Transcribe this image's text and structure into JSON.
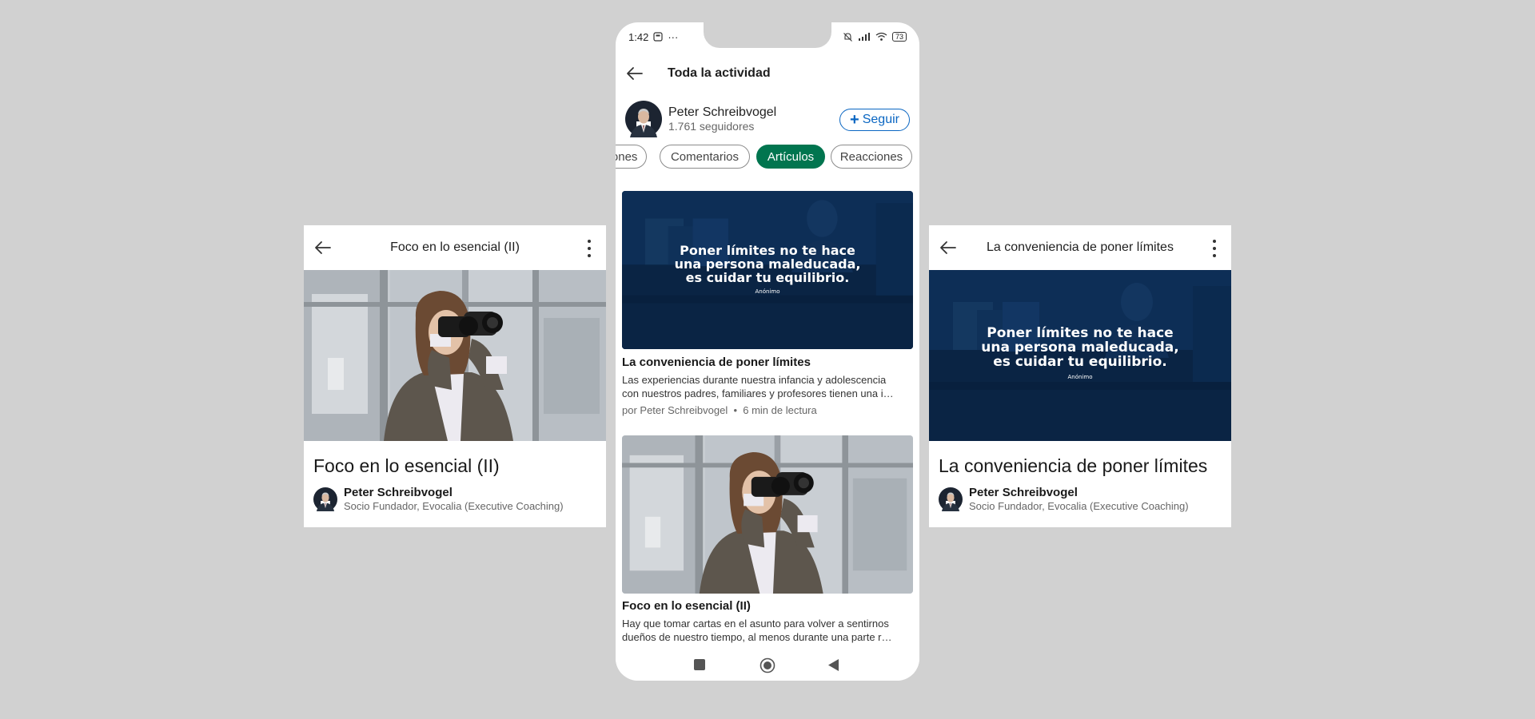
{
  "left_card": {
    "header_title": "Foco en lo esencial (II)",
    "article_title": "Foco en lo esencial (II)",
    "author_name": "Peter Schreibvogel",
    "author_subtitle": "Socio Fundador, Evocalia (Executive Coaching)"
  },
  "right_card": {
    "header_title": "La conveniencia de poner límites",
    "article_title": "La conveniencia de poner límites",
    "author_name": "Peter Schreibvogel",
    "author_subtitle": "Socio Fundador, Evocalia (Executive Coaching)"
  },
  "quote_image": {
    "line1": "Poner límites no te hace",
    "line2": "una persona maleducada,",
    "line3": "es cuidar tu equilibrio.",
    "attribution": "Anónimo"
  },
  "phone": {
    "status": {
      "time": "1:42",
      "dots": "···",
      "battery": "73"
    },
    "topbar_title": "Toda la actividad",
    "profile": {
      "name": "Peter Schreibvogel",
      "followers": "1.761 seguidores",
      "follow_label": "Seguir",
      "follow_plus": "+"
    },
    "filters": [
      {
        "label": "iones",
        "active": false
      },
      {
        "label": "Comentarios",
        "active": false
      },
      {
        "label": "Artículos",
        "active": true
      },
      {
        "label": "Reacciones",
        "active": false
      }
    ],
    "posts": [
      {
        "title": "La conveniencia de poner límites",
        "snippet_line1": "Las experiencias durante nuestra infancia y adolescencia",
        "snippet_line2": "con nuestros padres, familiares y profesores tienen una i…",
        "meta": "por Peter Schreibvogel  •  6 min de lectura"
      },
      {
        "title": "Foco en lo esencial (II)",
        "snippet_line1": "Hay que tomar cartas en el asunto para volver a sentirnos",
        "snippet_line2": "dueños de nuestro tiempo, al menos durante una parte r…"
      }
    ]
  },
  "colors": {
    "background": "#d1d1d1",
    "follow_blue": "#0a66c2",
    "active_chip_green": "#01754f",
    "quote_navy": "#0c2a4f"
  }
}
